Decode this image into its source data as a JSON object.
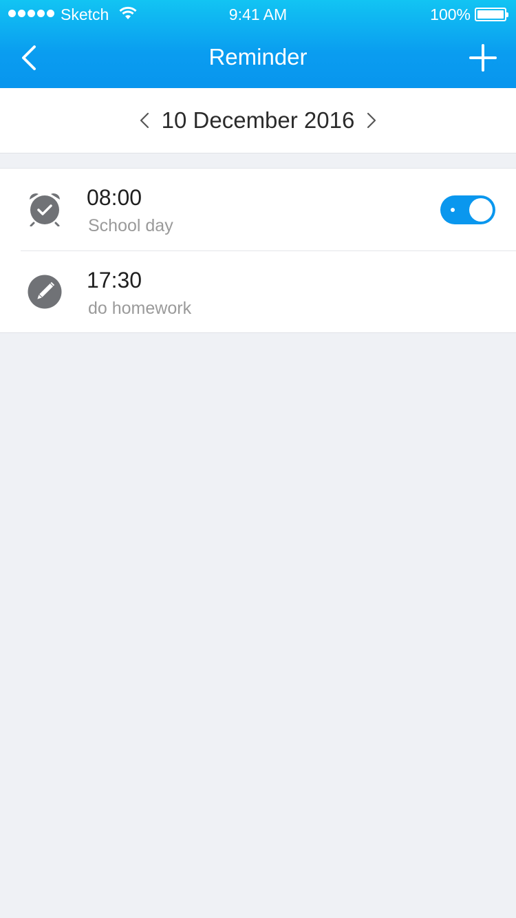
{
  "status_bar": {
    "carrier": "Sketch",
    "time": "9:41 AM",
    "battery": "100%"
  },
  "header": {
    "title": "Reminder",
    "back_icon": "chevron-left-icon",
    "add_icon": "plus-icon"
  },
  "date_nav": {
    "date": "10 December 2016",
    "prev_icon": "chevron-left-icon",
    "next_icon": "chevron-right-icon"
  },
  "reminders": [
    {
      "time": "08:00",
      "label": "School day",
      "icon": "alarm-clock-check-icon",
      "toggle_on": true
    },
    {
      "time": "17:30",
      "label": "do homework",
      "icon": "pencil-edit-icon"
    }
  ],
  "colors": {
    "accent": "#0a97ee",
    "header_top": "#12c4f3",
    "icon_gray": "#707276",
    "background": "#eff1f5"
  }
}
